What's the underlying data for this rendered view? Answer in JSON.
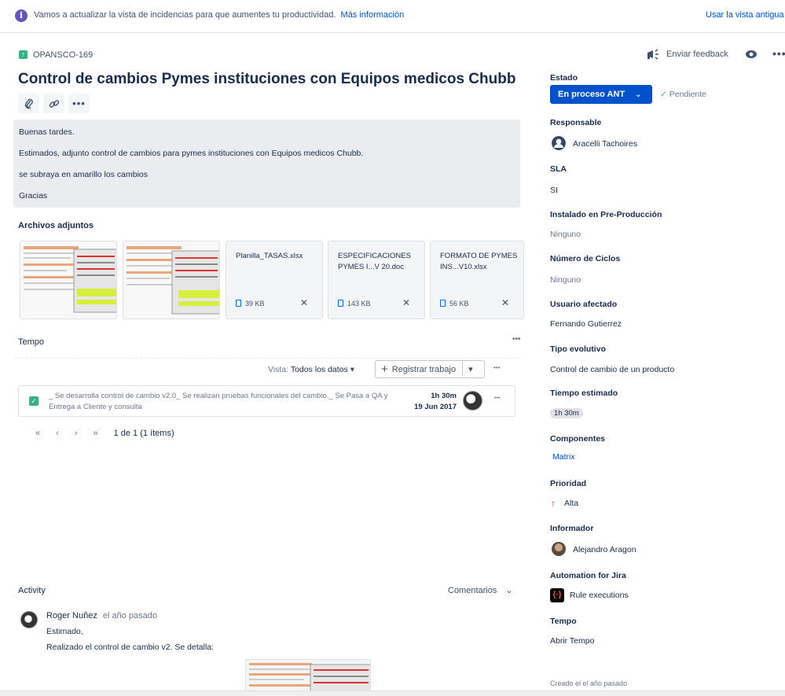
{
  "banner": {
    "message": "Vamos a actualizar la vista de incidencias para que aumentes tu productividad.",
    "link": "Más información",
    "old_view": "Usar la vista antigua"
  },
  "issue": {
    "key": "OPANSCO-169",
    "title": "Control de cambios Pymes instituciones con Equipos medicos Chubb",
    "feedback": "Enviar feedback",
    "description": [
      "Buenas tardes.",
      "Estimados, adjunto control de cambios para pymes instituciones con Equipos medicos Chubb.",
      "se subraya en amarillo los cambios",
      "Gracias"
    ]
  },
  "attachments": {
    "heading": "Archivos adjuntos",
    "files": [
      {
        "name": "Planilla_TASAS.xlsx",
        "size": "39 KB"
      },
      {
        "name": "ESPECIFICACIONES PYMES I...V 20.doc",
        "size": "143 KB"
      },
      {
        "name": "FORMATO DE PYMES INS...V10.xlsx",
        "size": "56 KB"
      }
    ]
  },
  "tempo": {
    "heading": "Tempo",
    "view_label": "Vista:",
    "view_value": "Todos los datos",
    "register": "Registrar trabajo",
    "worklog": {
      "text": "_ Se desarrolla control de cambio v2.0_ Se realizan pruebas funcionales del cambio._ Se Pasa a QA y Entrega a Cliente y consulta",
      "duration": "1h 30m",
      "date": "19 Jun 2017"
    },
    "pagination": "1 de 1 (1 ítems)"
  },
  "activity": {
    "heading": "Activity",
    "filter": "Comentarios",
    "comment": {
      "author": "Roger Nuñez",
      "time": "el año pasado",
      "lines": [
        "Estimado,",
        "Realizado el control de cambio v2. Se detalla:"
      ]
    }
  },
  "sidebar": {
    "estado_label": "Estado",
    "estado_value": "En proceso ANT",
    "pendiente": "Pendiente",
    "responsable_label": "Responsable",
    "responsable_value": "Aracelli Tachoires",
    "sla_label": "SLA",
    "sla_value": "SI",
    "instalado_label": "Instalado en Pre-Producción",
    "instalado_value": "Ninguno",
    "ciclos_label": "Número de Ciclos",
    "ciclos_value": "Ninguno",
    "usuario_label": "Usuario afectado",
    "usuario_value": "Fernando Gutierrez",
    "tipo_label": "Tipo evolutivo",
    "tipo_value": "Control de cambio de un producto",
    "tiempo_label": "Tiempo estimado",
    "tiempo_value": "1h 30m",
    "componentes_label": "Componentes",
    "componentes_value": "Matrix",
    "prioridad_label": "Prioridad",
    "prioridad_value": "Alta",
    "informador_label": "Informador",
    "informador_value": "Alejandro Aragon",
    "automation_label": "Automation for Jira",
    "automation_value": "Rule executions",
    "tempo_label": "Tempo",
    "tempo_value": "Abrir Tempo",
    "creado": "Creado el el año pasado"
  },
  "colors": {
    "primary": "#0052cc",
    "success": "#36b37e",
    "priority_high": "#de350b"
  }
}
